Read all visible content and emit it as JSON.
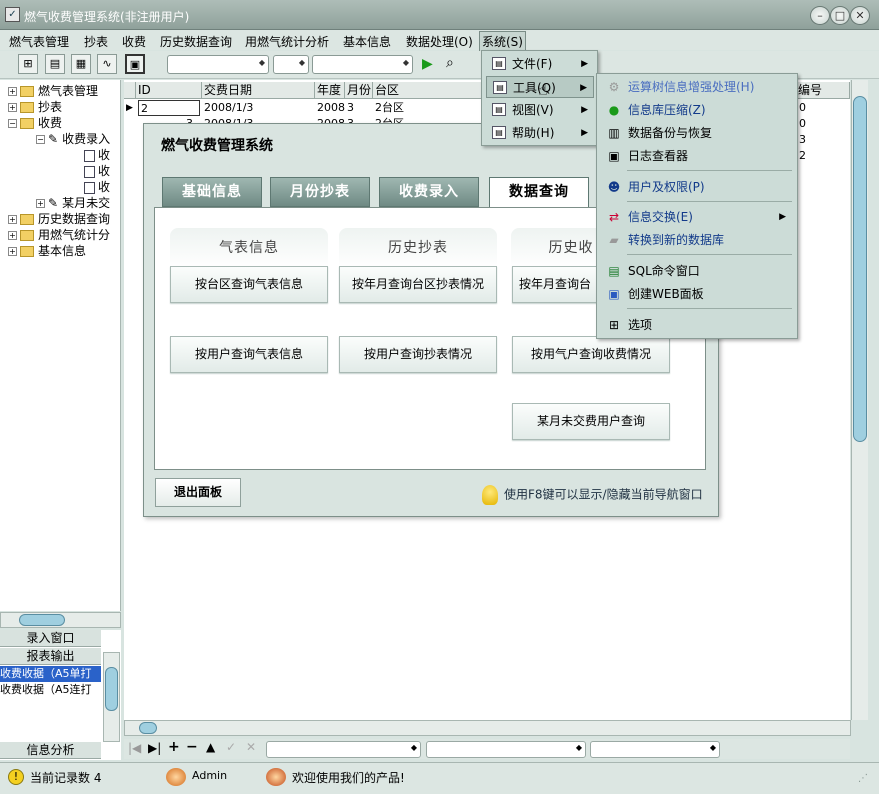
{
  "window": {
    "title": "燃气收费管理系统(非注册用户)"
  },
  "menubar": [
    "燃气表管理",
    "抄表",
    "收费",
    "历史数据查询",
    "用燃气统计分析",
    "基本信息",
    "数据处理(O)",
    "系统(S)"
  ],
  "tree": {
    "items": [
      "燃气表管理",
      "抄表",
      "收费",
      "收费录入",
      "收",
      "收",
      "收",
      "某月未交",
      "历史数据查询",
      "用燃气统计分",
      "基本信息"
    ]
  },
  "side_panels": {
    "entry_window": "录入窗口",
    "report_output": "报表输出",
    "report_items": [
      "收费收据（A5单打",
      "收费收据（A5连打"
    ],
    "info_analysis": "信息分析"
  },
  "grid": {
    "headers": [
      "ID",
      "交费日期",
      "年度",
      "月份",
      "台区",
      "表编号"
    ],
    "rows": [
      {
        "id": "2",
        "date": "2008/1/3",
        "year": "2008",
        "month": "3",
        "area": "2台区",
        "meter": "0"
      },
      {
        "id": "3",
        "date": "2008/1/3",
        "year": "2008",
        "month": "3",
        "area": "2台区",
        "meter": "0"
      }
    ],
    "meter_partial": [
      "0",
      "0",
      "3",
      "2"
    ]
  },
  "dialog": {
    "title": "燃气收费管理系统",
    "tabs": [
      "基础信息",
      "月份抄表",
      "收费录入",
      "数据查询"
    ],
    "groups": [
      {
        "title": "气表信息",
        "buttons": [
          "按台区查询气表信息",
          "按用户查询气表信息"
        ]
      },
      {
        "title": "历史抄表",
        "buttons": [
          "按年月查询台区抄表情况",
          "按用户查询抄表情况"
        ]
      },
      {
        "title": "历史收",
        "buttons": [
          "按年月查询台",
          "按用气户查询收费情况",
          "某月未交费用户查询"
        ]
      }
    ],
    "exit_label": "退出面板",
    "hint": "使用F8键可以显示/隐藏当前导航窗口"
  },
  "system_menu": [
    "文件(F)",
    "工具(Q)",
    "视图(V)",
    "帮助(H)"
  ],
  "tools_menu": [
    "运算树信息增强处理(H)",
    "信息库压缩(Z)",
    "数据备份与恢复",
    "日志查看器",
    "用户及权限(P)",
    "信息交换(E)",
    "转换到新的数据库",
    "SQL命令窗口",
    "创建WEB面板",
    "选项"
  ],
  "status": {
    "record_count": "当前记录数 4",
    "user": "Admin",
    "welcome": "欢迎使用我们的产品!"
  }
}
